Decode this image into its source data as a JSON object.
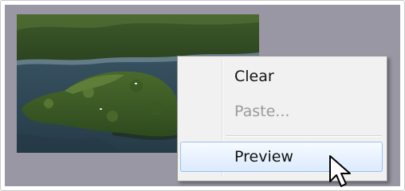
{
  "context_menu": {
    "items": [
      {
        "label": "Clear",
        "enabled": true,
        "highlighted": false
      },
      {
        "label": "Paste...",
        "enabled": false,
        "highlighted": false
      },
      {
        "label": "Preview",
        "enabled": true,
        "highlighted": true
      }
    ]
  },
  "colors": {
    "stage_background": "#9a97a4",
    "menu_background": "#f1f1f1",
    "highlight_border": "#9dc0ea",
    "disabled_text": "#9a9a9a"
  },
  "icons": {
    "cursor": "arrow-pointer-icon"
  }
}
